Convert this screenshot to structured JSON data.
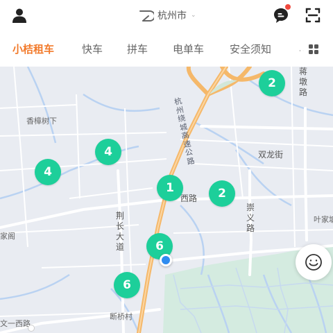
{
  "header": {
    "city": "杭州市",
    "avatar_icon": "user-avatar-icon",
    "message_icon": "message-bubble-icon",
    "scan_icon": "scan-icon",
    "notification_color": "#f0493e"
  },
  "tabs": [
    {
      "label": "小桔租车",
      "active": true
    },
    {
      "label": "快车",
      "active": false
    },
    {
      "label": "拼车",
      "active": false
    },
    {
      "label": "电单车",
      "active": false
    },
    {
      "label": "安全须知",
      "active": false
    },
    {
      "label": "…",
      "active": false
    }
  ],
  "accent_color": "#f27a2b",
  "map": {
    "labels": {
      "xiangzhang": "香樟树下",
      "shuanglong": "双龙街",
      "xilu": "西路",
      "jiating": "家阁",
      "yejia": "叶家塘",
      "wenyi": "文一西路",
      "duanqiao": "断桥村",
      "jiangdun": "蒋墩路",
      "jingchang": "荆长大道",
      "chongyi": "崇义路",
      "highway": "杭州绕城高速公路"
    },
    "clusters": [
      {
        "name": "cluster-2-ne",
        "count": "2"
      },
      {
        "name": "cluster-4-center",
        "count": "4"
      },
      {
        "name": "cluster-4-west",
        "count": "4"
      },
      {
        "name": "cluster-1",
        "count": "1"
      },
      {
        "name": "cluster-2-east",
        "count": "2"
      },
      {
        "name": "cluster-6-upper",
        "count": "6"
      },
      {
        "name": "cluster-6-lower",
        "count": "6"
      }
    ],
    "cluster_color": "#1dcf9a",
    "location_color": "#2f8cf0"
  }
}
